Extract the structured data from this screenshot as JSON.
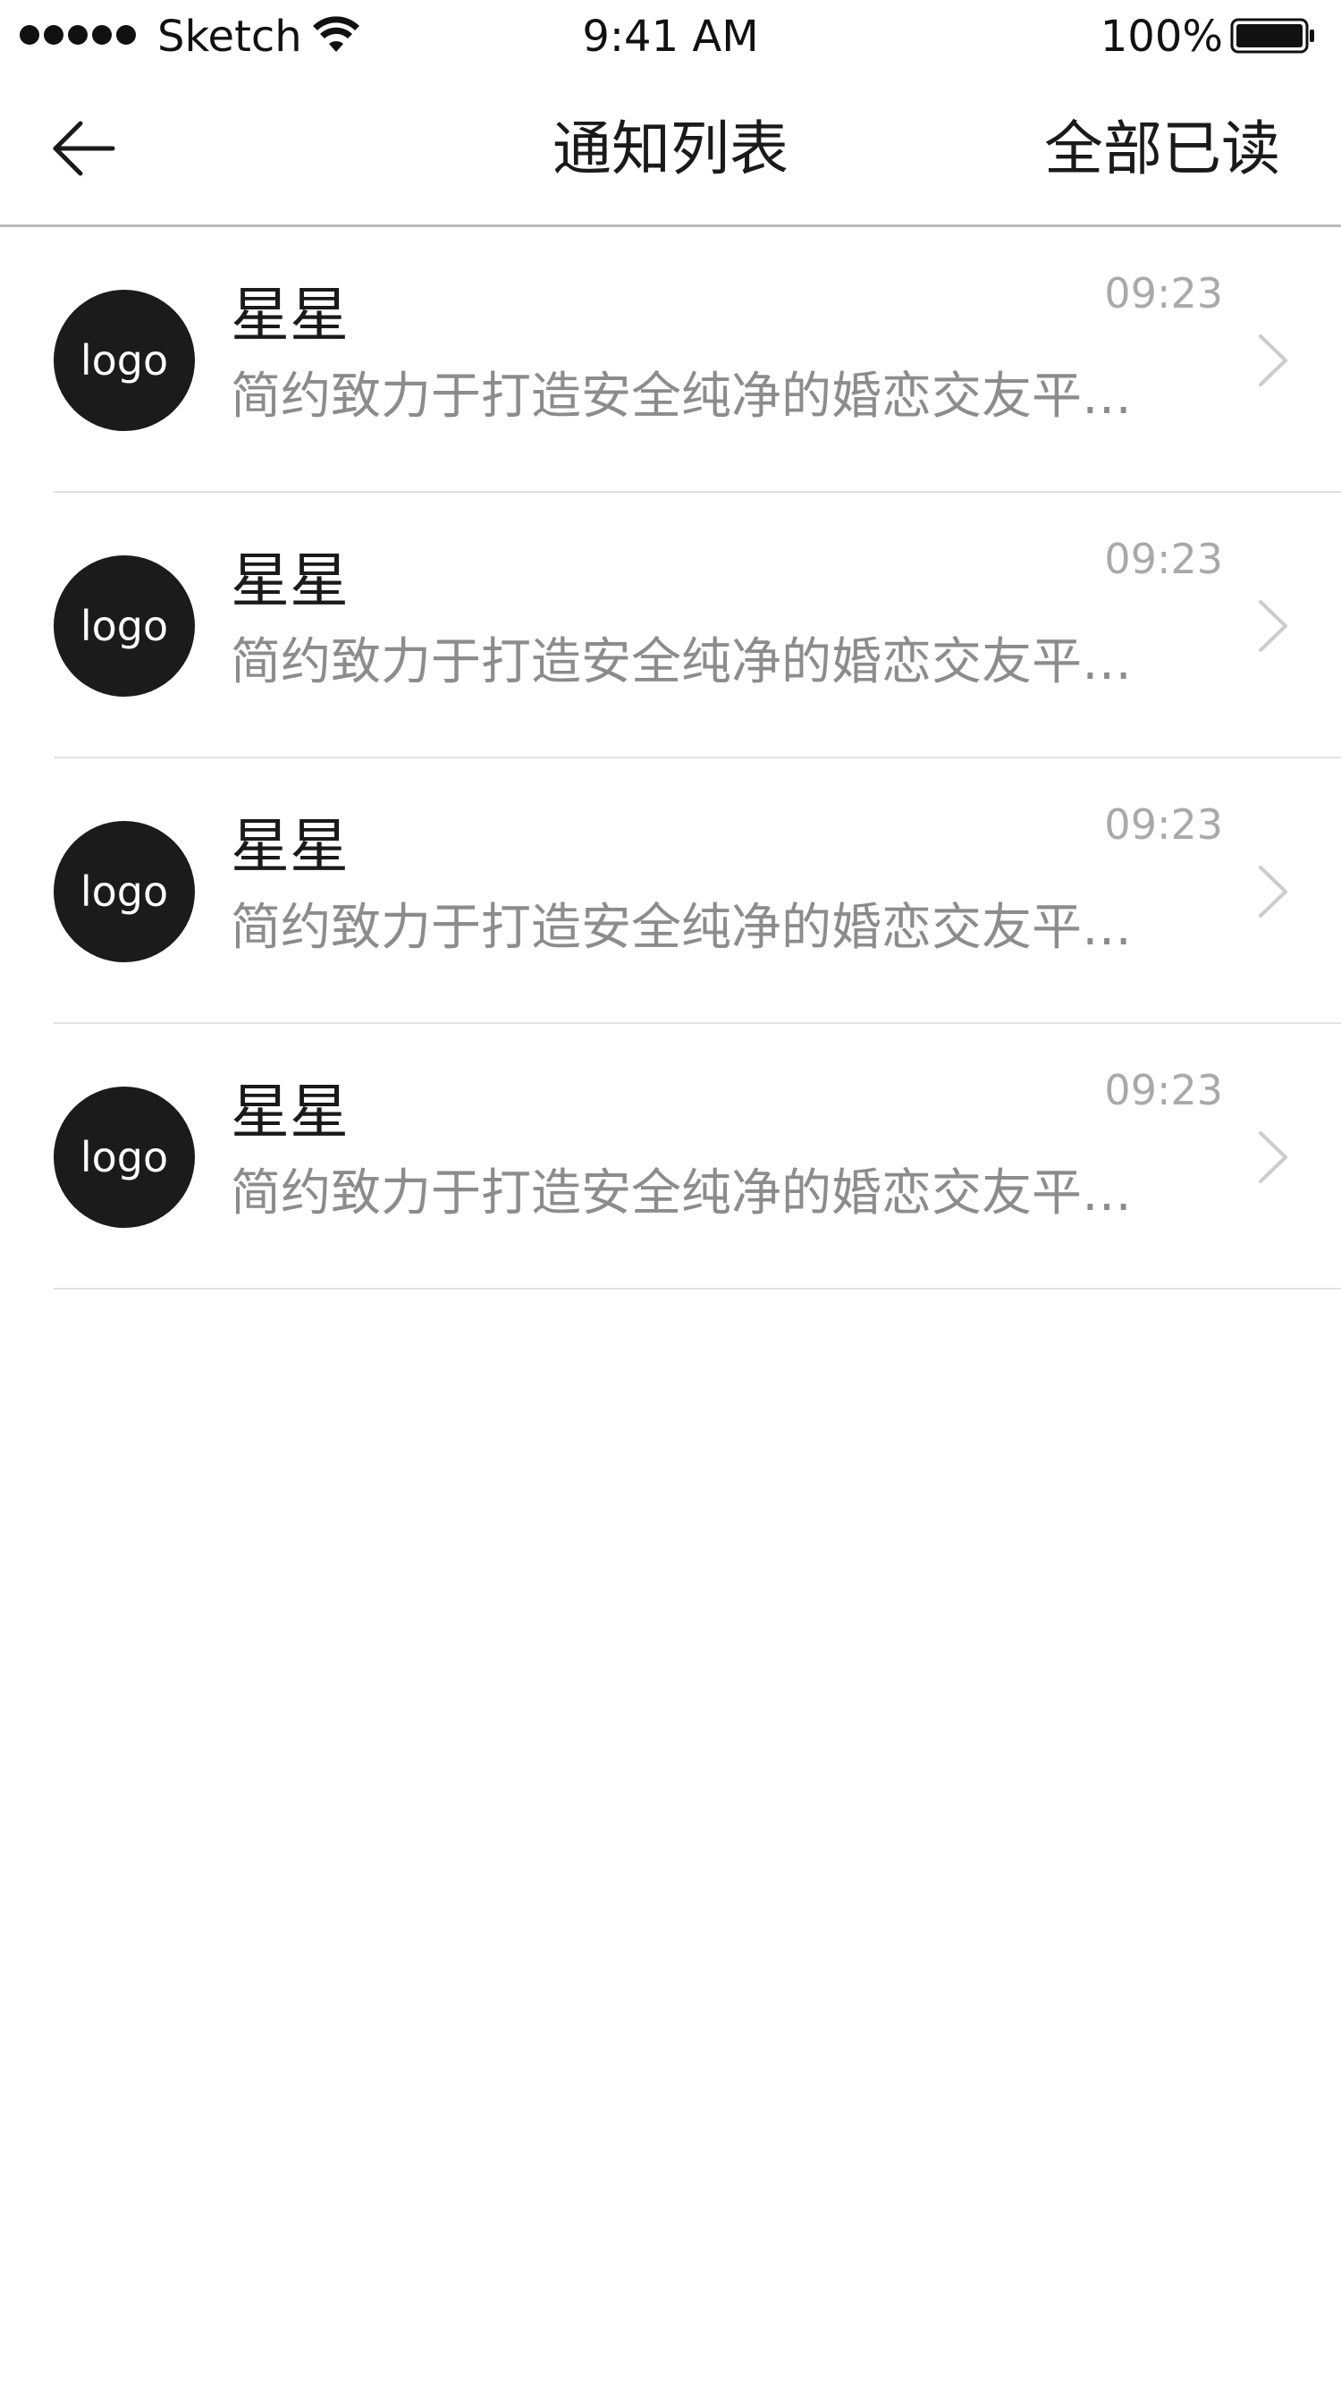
{
  "status_bar": {
    "carrier": "Sketch",
    "time": "9:41 AM",
    "battery": "100%",
    "icons": [
      "signal-dots-icon",
      "wifi-icon",
      "battery-icon"
    ]
  },
  "nav": {
    "title": "通知列表",
    "right_action": "全部已读",
    "back_icon": "arrow-left-icon"
  },
  "notifications": [
    {
      "avatar_label": "logo",
      "name": "星星",
      "time": "09:23",
      "text": "简约致力于打造安全纯净的婚恋交友平台..."
    },
    {
      "avatar_label": "logo",
      "name": "星星",
      "time": "09:23",
      "text": "简约致力于打造安全纯净的婚恋交友平台..."
    },
    {
      "avatar_label": "logo",
      "name": "星星",
      "time": "09:23",
      "text": "简约致力于打造安全纯净的婚恋交友平台..."
    },
    {
      "avatar_label": "logo",
      "name": "星星",
      "time": "09:23",
      "text": "简约致力于打造安全纯净的婚恋交友平台..."
    }
  ],
  "colors": {
    "primary_text": "#1a1a1a",
    "secondary_text": "#8c8c8c",
    "time_text": "#a9a9a9",
    "avatar_bg": "#1b1b1b",
    "divider": "#e2e2e2",
    "chevron": "#cccccc"
  }
}
